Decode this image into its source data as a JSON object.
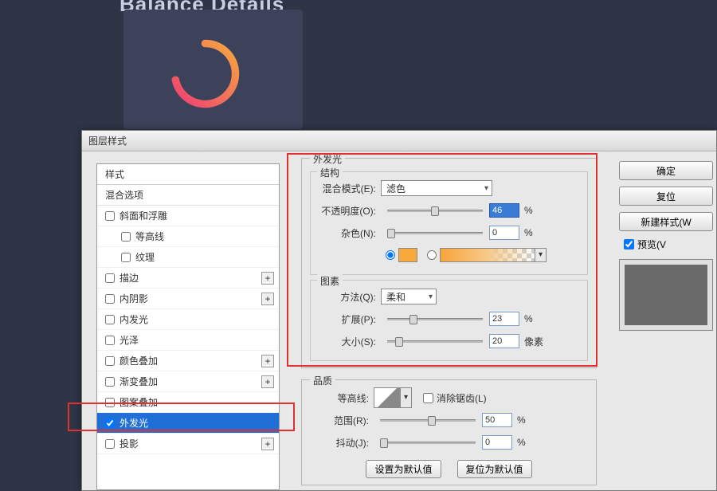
{
  "page_title": "Balance Details",
  "dialog": {
    "title": "图层样式"
  },
  "styles_panel": {
    "header": "样式",
    "blend_options": "混合选项",
    "items": [
      {
        "label": "斜面和浮雕",
        "plus": false,
        "sub": false
      },
      {
        "label": "等高线",
        "plus": false,
        "sub": true
      },
      {
        "label": "纹理",
        "plus": false,
        "sub": true
      },
      {
        "label": "描边",
        "plus": true,
        "sub": false
      },
      {
        "label": "内阴影",
        "plus": true,
        "sub": false
      },
      {
        "label": "内发光",
        "plus": false,
        "sub": false
      },
      {
        "label": "光泽",
        "plus": false,
        "sub": false
      },
      {
        "label": "颜色叠加",
        "plus": true,
        "sub": false
      },
      {
        "label": "渐变叠加",
        "plus": true,
        "sub": false
      },
      {
        "label": "图案叠加",
        "plus": false,
        "sub": false
      },
      {
        "label": "外发光",
        "plus": false,
        "sub": false,
        "selected": true,
        "checked": true
      },
      {
        "label": "投影",
        "plus": true,
        "sub": false
      }
    ]
  },
  "outer_glow": {
    "title": "外发光",
    "structure": {
      "title": "结构",
      "blend_mode_label": "混合模式(E):",
      "blend_mode_value": "滤色",
      "opacity_label": "不透明度(O):",
      "opacity_value": "46",
      "opacity_unit": "%",
      "noise_label": "杂色(N):",
      "noise_value": "0",
      "noise_unit": "%",
      "solid_color": "#f7a93e"
    },
    "elements": {
      "title": "图素",
      "technique_label": "方法(Q):",
      "technique_value": "柔和",
      "spread_label": "扩展(P):",
      "spread_value": "23",
      "spread_unit": "%",
      "size_label": "大小(S):",
      "size_value": "20",
      "size_unit": "像素"
    },
    "quality": {
      "title": "品质",
      "contour_label": "等高线:",
      "antialias_label": "消除锯齿(L)",
      "range_label": "范围(R):",
      "range_value": "50",
      "range_unit": "%",
      "jitter_label": "抖动(J):",
      "jitter_value": "0",
      "jitter_unit": "%"
    },
    "defaults": {
      "make": "设置为默认值",
      "reset": "复位为默认值"
    }
  },
  "buttons": {
    "ok": "确定",
    "cancel": "复位",
    "new_style": "新建样式(W",
    "preview": "预览(V"
  }
}
